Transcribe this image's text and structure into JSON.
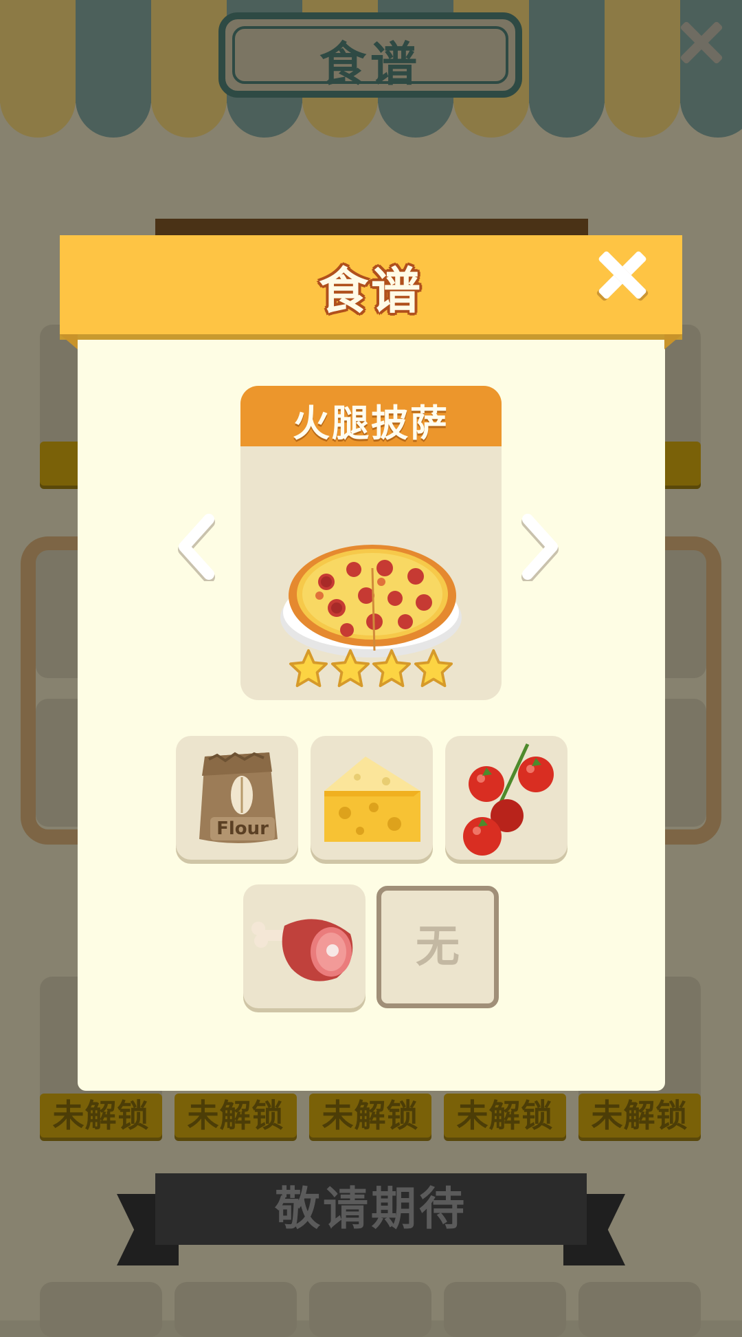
{
  "background": {
    "title": "食谱",
    "locked_label": "未解锁",
    "coming_soon": "敬请期待"
  },
  "modal": {
    "title": "食谱",
    "recipe": {
      "name": "火腿披萨",
      "image": "pizza-icon",
      "rating": 4,
      "rating_max": 4
    },
    "ingredients": [
      {
        "name": "flour-icon",
        "label": "Flour"
      },
      {
        "name": "cheese-icon"
      },
      {
        "name": "tomato-icon"
      },
      {
        "name": "ham-icon"
      },
      {
        "name": "empty-slot",
        "label": "无"
      }
    ]
  },
  "colors": {
    "header": "#fec444",
    "body": "#fefde4",
    "recipe_header": "#ec962c",
    "card": "#ece4cd"
  }
}
